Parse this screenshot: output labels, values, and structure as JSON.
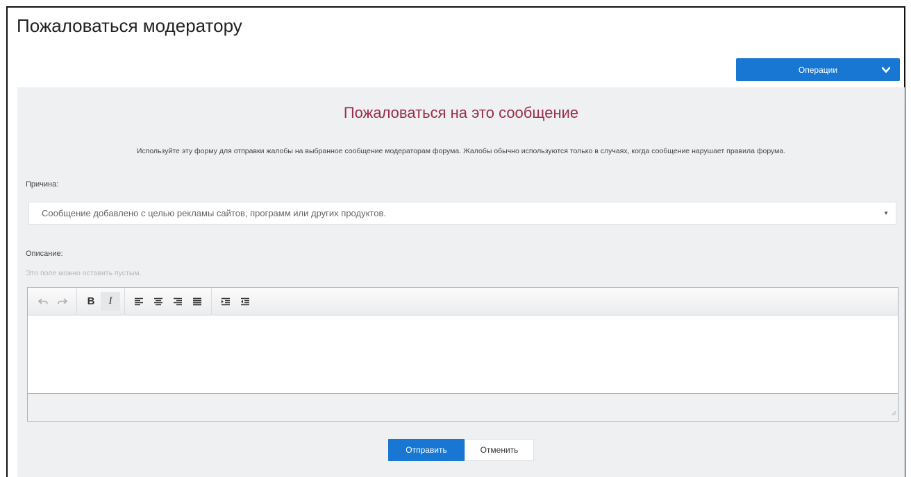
{
  "page": {
    "title": "Пожаловаться модератору"
  },
  "operations": {
    "label": "Операции",
    "icon": "chevron-down-icon"
  },
  "form": {
    "heading": "Пожаловаться на это сообщение",
    "intro": "Используйте эту форму для отправки жалобы на выбранное сообщение модераторам форума. Жалобы обычно используются только в случаях, когда сообщение нарушает правила форума.",
    "reason_label": "Причина:",
    "reason_value": "Сообщение добавлено с целью рекламы сайтов, программ или других продуктов.",
    "description_label": "Описание:",
    "description_hint": "Это поле можно оставить пустым.",
    "toolbar": [
      "undo-icon",
      "redo-icon",
      "bold-icon",
      "italic-icon",
      "align-left-icon",
      "align-center-icon",
      "align-right-icon",
      "align-justify-icon",
      "indent-icon",
      "outdent-icon"
    ],
    "bold_glyph": "B",
    "italic_glyph": "I",
    "submit_label": "Отправить",
    "cancel_label": "Отменить"
  },
  "colors": {
    "accent": "#1777d2",
    "heading": "#9a2f4a",
    "panel_bg": "#eef0f2"
  }
}
